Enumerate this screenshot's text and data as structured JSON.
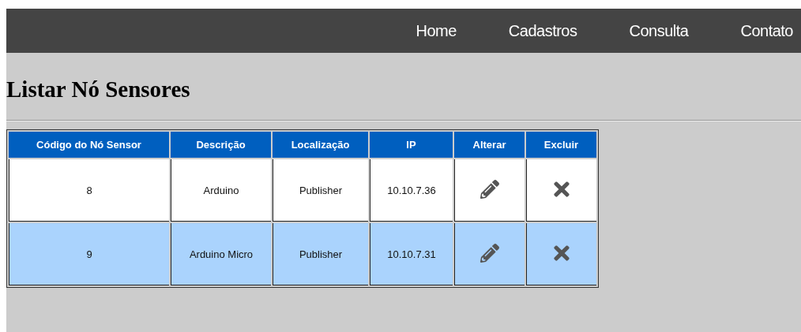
{
  "nav": {
    "items": [
      {
        "label": "Home"
      },
      {
        "label": "Cadastros"
      },
      {
        "label": "Consulta"
      },
      {
        "label": "Contato"
      }
    ]
  },
  "page": {
    "title": "Listar Nó Sensores"
  },
  "table": {
    "columns": [
      "Código do Nó Sensor",
      "Descrição",
      "Localização",
      "IP",
      "Alterar",
      "Excluir"
    ],
    "rows": [
      {
        "code": "8",
        "description": "Arduino",
        "location": "Publisher",
        "ip": "10.10.7.36",
        "selected": false
      },
      {
        "code": "9",
        "description": "Arduino Micro",
        "location": "Publisher",
        "ip": "10.10.7.31",
        "selected": true
      }
    ]
  }
}
